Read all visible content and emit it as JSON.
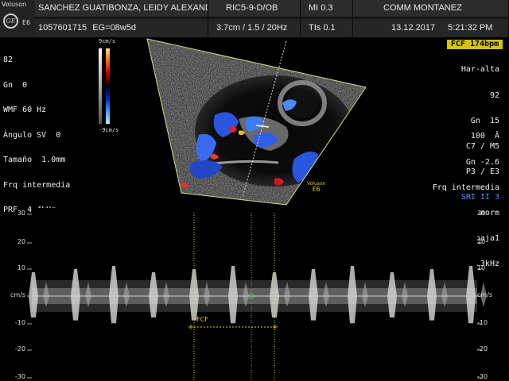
{
  "header": {
    "brand": "Voluson",
    "logo": "GE",
    "model": "E6",
    "patient_name": "SANCHEZ GUATIBONZA, LEIDY ALEXAND",
    "probe": "RIC5-9-D/OB",
    "mi": "MI  0.3",
    "operator": "COMM MONTANEZ",
    "patient_id": "1057601715",
    "ga": "EG=08w5d",
    "depth": "3.7cm / 1.5 / 20Hz",
    "tis": "TIs  0.1",
    "date": "13.12.2017",
    "time": "5:21:32 PM"
  },
  "doppler_left": {
    "lines": [
      "82",
      "Gn  0",
      "WMF 60 Hz",
      "Ángulo SV  0",
      "Tamaño  1.0mm",
      "Frq intermedia",
      "PRF  4.4kHz"
    ]
  },
  "color_scale": {
    "top": "9cm/s",
    "bottom": "-9cm/s"
  },
  "right_panel": {
    "fcf": "FCF 174bpm",
    "top_lines": [
      "Har-alta",
      "92",
      "Gn  15",
      "C7 / M5",
      "P3 / E3"
    ],
    "sri": "SRI II 3",
    "bottom_lines": [
      "100  Â",
      "Gn -2.6",
      "Frq intermedia",
      "Calidad norm",
      "WMF baja1",
      "PRF  1.3kHz"
    ]
  },
  "image_watermark": {
    "brand": "Voluson",
    "model": "E6"
  },
  "spectral": {
    "left_ticks": [
      "30",
      "20",
      "10",
      "cm/s",
      "-10",
      "-20",
      "-30"
    ],
    "right_ticks": [
      "30",
      "20",
      "10",
      "cm/s",
      "-10",
      "-20",
      "-30"
    ],
    "fcf_caliper_label": "FCF",
    "heart_rate_bpm": 174
  },
  "colors": {
    "fcf_highlight": "#d6c20d",
    "sri": "#4f8cff",
    "caliper": "#e0d000",
    "cursor": "#3fd65a"
  }
}
